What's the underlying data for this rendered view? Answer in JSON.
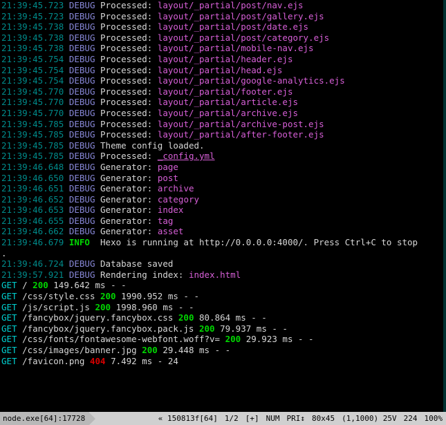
{
  "log_lines": [
    {
      "ts": "21:39:45.723",
      "level": "DEBUG",
      "msg": "Processed:",
      "path": "layout/_partial/post/nav.ejs"
    },
    {
      "ts": "21:39:45.723",
      "level": "DEBUG",
      "msg": "Processed:",
      "path": "layout/_partial/post/gallery.ejs"
    },
    {
      "ts": "21:39:45.738",
      "level": "DEBUG",
      "msg": "Processed:",
      "path": "layout/_partial/post/date.ejs"
    },
    {
      "ts": "21:39:45.738",
      "level": "DEBUG",
      "msg": "Processed:",
      "path": "layout/_partial/post/category.ejs"
    },
    {
      "ts": "21:39:45.738",
      "level": "DEBUG",
      "msg": "Processed:",
      "path": "layout/_partial/mobile-nav.ejs"
    },
    {
      "ts": "21:39:45.754",
      "level": "DEBUG",
      "msg": "Processed:",
      "path": "layout/_partial/header.ejs"
    },
    {
      "ts": "21:39:45.754",
      "level": "DEBUG",
      "msg": "Processed:",
      "path": "layout/_partial/head.ejs"
    },
    {
      "ts": "21:39:45.754",
      "level": "DEBUG",
      "msg": "Processed:",
      "path": "layout/_partial/google-analytics.ejs"
    },
    {
      "ts": "21:39:45.770",
      "level": "DEBUG",
      "msg": "Processed:",
      "path": "layout/_partial/footer.ejs"
    },
    {
      "ts": "21:39:45.770",
      "level": "DEBUG",
      "msg": "Processed:",
      "path": "layout/_partial/article.ejs"
    },
    {
      "ts": "21:39:45.770",
      "level": "DEBUG",
      "msg": "Processed:",
      "path": "layout/_partial/archive.ejs"
    },
    {
      "ts": "21:39:45.785",
      "level": "DEBUG",
      "msg": "Processed:",
      "path": "layout/_partial/archive-post.ejs"
    },
    {
      "ts": "21:39:45.785",
      "level": "DEBUG",
      "msg": "Processed:",
      "path": "layout/_partial/after-footer.ejs"
    },
    {
      "ts": "21:39:45.785",
      "level": "DEBUG",
      "msg": "Theme config loaded."
    },
    {
      "ts": "21:39:45.785",
      "level": "DEBUG",
      "msg": "Processed:",
      "path": "_config.yml",
      "underline": true
    },
    {
      "ts": "21:39:46.648",
      "level": "DEBUG",
      "msg": "Generator:",
      "path": "page"
    },
    {
      "ts": "21:39:46.650",
      "level": "DEBUG",
      "msg": "Generator:",
      "path": "post"
    },
    {
      "ts": "21:39:46.651",
      "level": "DEBUG",
      "msg": "Generator:",
      "path": "archive"
    },
    {
      "ts": "21:39:46.652",
      "level": "DEBUG",
      "msg": "Generator:",
      "path": "category"
    },
    {
      "ts": "21:39:46.653",
      "level": "DEBUG",
      "msg": "Generator:",
      "path": "index"
    },
    {
      "ts": "21:39:46.655",
      "level": "DEBUG",
      "msg": "Generator:",
      "path": "tag"
    },
    {
      "ts": "21:39:46.662",
      "level": "DEBUG",
      "msg": "Generator:",
      "path": "asset"
    },
    {
      "ts": "21:39:46.679",
      "level": "INFO",
      "msg": "Hexo is running at http://0.0.0.0:4000/. Press Ctrl+C to stop",
      "cont": "."
    },
    {
      "ts": "21:39:46.724",
      "level": "DEBUG",
      "msg": "Database saved"
    },
    {
      "ts": "21:39:57.921",
      "level": "DEBUG",
      "msg": "Rendering index:",
      "path": "index.html"
    }
  ],
  "http_lines": [
    {
      "method": "GET",
      "url": "/",
      "code": "200",
      "time": "149.642 ms",
      "tail": "- -"
    },
    {
      "method": "GET",
      "url": "/css/style.css",
      "code": "200",
      "time": "1990.952 ms",
      "tail": "- -"
    },
    {
      "method": "GET",
      "url": "/js/script.js",
      "code": "200",
      "time": "1998.960 ms",
      "tail": "- -"
    },
    {
      "method": "GET",
      "url": "/fancybox/jquery.fancybox.css",
      "code": "200",
      "time": "80.864 ms",
      "tail": "- -"
    },
    {
      "method": "GET",
      "url": "/fancybox/jquery.fancybox.pack.js",
      "code": "200",
      "time": "79.937 ms",
      "tail": "- -"
    },
    {
      "method": "GET",
      "url": "/css/fonts/fontawesome-webfont.woff?v=",
      "code": "200",
      "time": "29.923 ms",
      "tail": "- -"
    },
    {
      "method": "GET",
      "url": "/css/images/banner.jpg",
      "code": "200",
      "time": "29.448 ms",
      "tail": "- -"
    },
    {
      "method": "GET",
      "url": "/favicon.png",
      "code": "404",
      "time": "7.492 ms",
      "tail": "- 24"
    }
  ],
  "status": {
    "left": "node.exe[64]:17728",
    "cells": [
      "« 150813f[64]",
      "1/2",
      "[+]",
      "NUM",
      "PRI↕",
      "80x45",
      "(1,1000) 25V",
      "224",
      "100%"
    ]
  }
}
